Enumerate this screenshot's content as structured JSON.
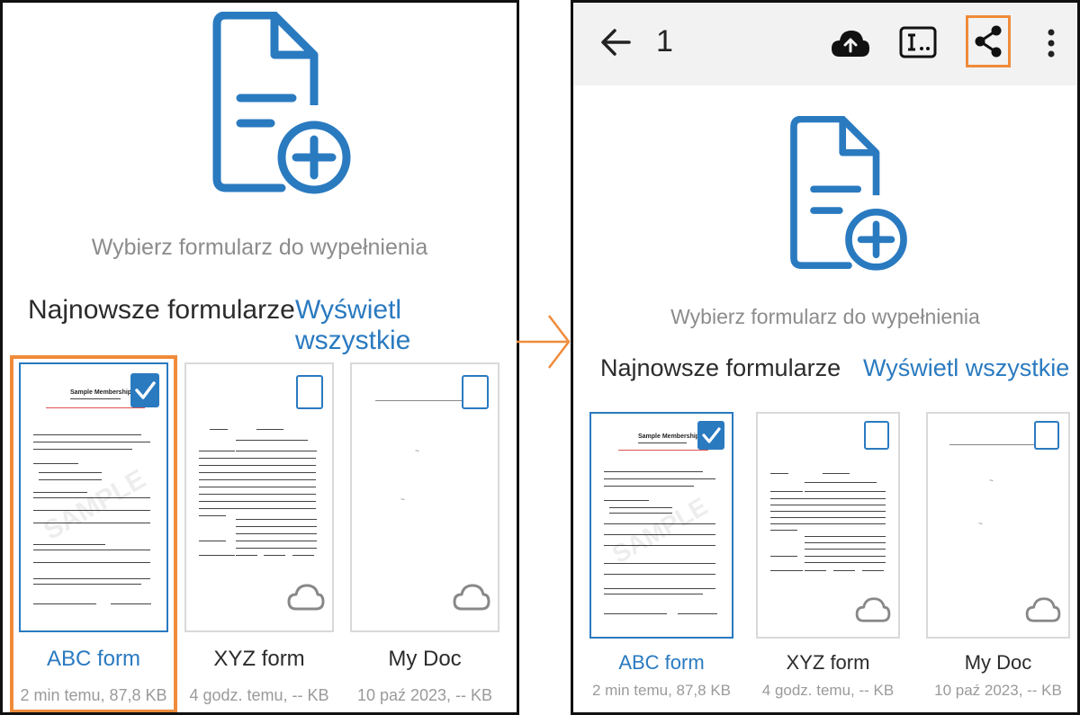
{
  "screen": {
    "prompt": "Wybierz formularz do wypełnienia",
    "section_title": "Najnowsze formularze",
    "view_all": "Wyświetl wszystkie"
  },
  "toolbar": {
    "count": "1",
    "icons": [
      "back-arrow-icon",
      "cloud-upload-icon",
      "rename-icon",
      "share-icon",
      "more-vert-icon"
    ]
  },
  "forms": [
    {
      "name": "ABC form",
      "meta": "2 min temu, 87,8 KB",
      "selected": true
    },
    {
      "name": "XYZ form",
      "meta": "4 godz. temu, -- KB",
      "selected": false
    },
    {
      "name": "My Doc",
      "meta": "10 paź 2023, -- KB",
      "selected": false
    }
  ],
  "thumbnail_text": {
    "abc_title": "Sample Membership Form",
    "watermark": "SAMPLE"
  },
  "colors": {
    "accent": "#2a7ac0",
    "highlight": "#f08b3a",
    "topbar": "#f2f2f2"
  }
}
